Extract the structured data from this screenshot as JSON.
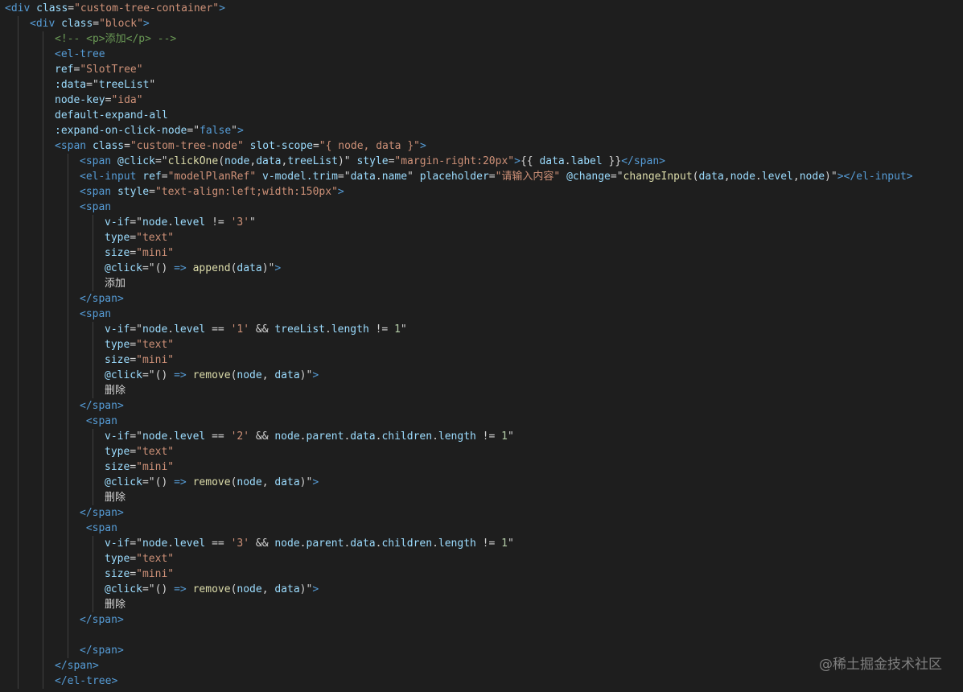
{
  "editor": {
    "language": "vue-html",
    "theme": "dark",
    "lines": [
      {
        "indent": 0,
        "tokens": [
          [
            "tag",
            "<div"
          ],
          [
            "text",
            " "
          ],
          [
            "attr",
            "class"
          ],
          [
            "text",
            "="
          ],
          [
            "str",
            "\"custom-tree-container\""
          ],
          [
            "tag",
            ">"
          ]
        ]
      },
      {
        "indent": 1,
        "tokens": [
          [
            "tag",
            "<div"
          ],
          [
            "text",
            " "
          ],
          [
            "attr",
            "class"
          ],
          [
            "text",
            "="
          ],
          [
            "str",
            "\"block\""
          ],
          [
            "tag",
            ">"
          ]
        ]
      },
      {
        "indent": 2,
        "tokens": [
          [
            "comment",
            "<!-- <p>添加</p> -->"
          ]
        ]
      },
      {
        "indent": 2,
        "tokens": [
          [
            "tag",
            "<el-tree"
          ]
        ]
      },
      {
        "indent": 2,
        "tokens": [
          [
            "attr",
            "ref"
          ],
          [
            "text",
            "="
          ],
          [
            "str",
            "\"SlotTree\""
          ]
        ]
      },
      {
        "indent": 2,
        "tokens": [
          [
            "attr",
            ":data"
          ],
          [
            "text",
            "=\""
          ],
          [
            "attr",
            "treeList"
          ],
          [
            "text",
            "\""
          ]
        ]
      },
      {
        "indent": 2,
        "tokens": [
          [
            "attr",
            "node-key"
          ],
          [
            "text",
            "="
          ],
          [
            "str",
            "\"ida\""
          ]
        ]
      },
      {
        "indent": 2,
        "tokens": [
          [
            "attr",
            "default-expand-all"
          ]
        ]
      },
      {
        "indent": 2,
        "tokens": [
          [
            "attr",
            ":expand-on-click-node"
          ],
          [
            "text",
            "=\""
          ],
          [
            "kw",
            "false"
          ],
          [
            "text",
            "\""
          ],
          [
            "tag",
            ">"
          ]
        ]
      },
      {
        "indent": 2,
        "tokens": [
          [
            "tag",
            "<span"
          ],
          [
            "text",
            " "
          ],
          [
            "attr",
            "class"
          ],
          [
            "text",
            "="
          ],
          [
            "str",
            "\"custom-tree-node\""
          ],
          [
            "text",
            " "
          ],
          [
            "attr",
            "slot-scope"
          ],
          [
            "text",
            "="
          ],
          [
            "str",
            "\"{ node, data }\""
          ],
          [
            "tag",
            ">"
          ]
        ]
      },
      {
        "indent": 3,
        "tokens": [
          [
            "tag",
            "<span"
          ],
          [
            "text",
            " "
          ],
          [
            "attr",
            "@click"
          ],
          [
            "text",
            "=\""
          ],
          [
            "fn",
            "clickOne"
          ],
          [
            "text",
            "("
          ],
          [
            "attr",
            "node"
          ],
          [
            "text",
            ","
          ],
          [
            "attr",
            "data"
          ],
          [
            "text",
            ","
          ],
          [
            "attr",
            "treeList"
          ],
          [
            "text",
            ")\" "
          ],
          [
            "attr",
            "style"
          ],
          [
            "text",
            "="
          ],
          [
            "str",
            "\"margin-right:20px\""
          ],
          [
            "tag",
            ">"
          ],
          [
            "text",
            "{{ "
          ],
          [
            "attr",
            "data"
          ],
          [
            "text",
            "."
          ],
          [
            "attr",
            "label"
          ],
          [
            "text",
            " }}"
          ],
          [
            "tag",
            "</span>"
          ]
        ]
      },
      {
        "indent": 3,
        "tokens": [
          [
            "tag",
            "<el-input"
          ],
          [
            "text",
            " "
          ],
          [
            "attr",
            "ref"
          ],
          [
            "text",
            "="
          ],
          [
            "str",
            "\"modelPlanRef\""
          ],
          [
            "text",
            " "
          ],
          [
            "attr",
            "v-model.trim"
          ],
          [
            "text",
            "=\""
          ],
          [
            "attr",
            "data"
          ],
          [
            "text",
            "."
          ],
          [
            "attr",
            "name"
          ],
          [
            "text",
            "\" "
          ],
          [
            "attr",
            "placeholder"
          ],
          [
            "text",
            "="
          ],
          [
            "str",
            "\"请输入内容\""
          ],
          [
            "text",
            " "
          ],
          [
            "attr",
            "@change"
          ],
          [
            "text",
            "=\""
          ],
          [
            "fn",
            "changeInput"
          ],
          [
            "text",
            "("
          ],
          [
            "attr",
            "data"
          ],
          [
            "text",
            ","
          ],
          [
            "attr",
            "node"
          ],
          [
            "text",
            "."
          ],
          [
            "attr",
            "level"
          ],
          [
            "text",
            ","
          ],
          [
            "attr",
            "node"
          ],
          [
            "text",
            ")\""
          ],
          [
            "tag",
            "></el-input>"
          ]
        ]
      },
      {
        "indent": 3,
        "tokens": [
          [
            "tag",
            "<span"
          ],
          [
            "text",
            " "
          ],
          [
            "attr",
            "style"
          ],
          [
            "text",
            "="
          ],
          [
            "str",
            "\"text-align:left;width:150px\""
          ],
          [
            "tag",
            ">"
          ]
        ]
      },
      {
        "indent": 3,
        "tokens": [
          [
            "tag",
            "<span"
          ]
        ]
      },
      {
        "indent": 4,
        "tokens": [
          [
            "attr",
            "v-if"
          ],
          [
            "text",
            "=\""
          ],
          [
            "attr",
            "node"
          ],
          [
            "text",
            "."
          ],
          [
            "attr",
            "level"
          ],
          [
            "text",
            " != "
          ],
          [
            "str",
            "'3'"
          ],
          [
            "text",
            "\""
          ]
        ]
      },
      {
        "indent": 4,
        "tokens": [
          [
            "attr",
            "type"
          ],
          [
            "text",
            "="
          ],
          [
            "str",
            "\"text\""
          ]
        ]
      },
      {
        "indent": 4,
        "tokens": [
          [
            "attr",
            "size"
          ],
          [
            "text",
            "="
          ],
          [
            "str",
            "\"mini\""
          ]
        ]
      },
      {
        "indent": 4,
        "tokens": [
          [
            "attr",
            "@click"
          ],
          [
            "text",
            "=\"() "
          ],
          [
            "kw",
            "=>"
          ],
          [
            "text",
            " "
          ],
          [
            "fn",
            "append"
          ],
          [
            "text",
            "("
          ],
          [
            "attr",
            "data"
          ],
          [
            "text",
            ")\""
          ],
          [
            "tag",
            ">"
          ]
        ]
      },
      {
        "indent": 4,
        "tokens": [
          [
            "text",
            "添加"
          ]
        ]
      },
      {
        "indent": 3,
        "tokens": [
          [
            "tag",
            "</span>"
          ]
        ]
      },
      {
        "indent": 3,
        "tokens": [
          [
            "tag",
            "<span"
          ]
        ]
      },
      {
        "indent": 4,
        "tokens": [
          [
            "attr",
            "v-if"
          ],
          [
            "text",
            "=\""
          ],
          [
            "attr",
            "node"
          ],
          [
            "text",
            "."
          ],
          [
            "attr",
            "level"
          ],
          [
            "text",
            " == "
          ],
          [
            "str",
            "'1'"
          ],
          [
            "text",
            " && "
          ],
          [
            "attr",
            "treeList"
          ],
          [
            "text",
            "."
          ],
          [
            "attr",
            "length"
          ],
          [
            "text",
            " != "
          ],
          [
            "num",
            "1"
          ],
          [
            "text",
            "\""
          ]
        ]
      },
      {
        "indent": 4,
        "tokens": [
          [
            "attr",
            "type"
          ],
          [
            "text",
            "="
          ],
          [
            "str",
            "\"text\""
          ]
        ]
      },
      {
        "indent": 4,
        "tokens": [
          [
            "attr",
            "size"
          ],
          [
            "text",
            "="
          ],
          [
            "str",
            "\"mini\""
          ]
        ]
      },
      {
        "indent": 4,
        "tokens": [
          [
            "attr",
            "@click"
          ],
          [
            "text",
            "=\"() "
          ],
          [
            "kw",
            "=>"
          ],
          [
            "text",
            " "
          ],
          [
            "fn",
            "remove"
          ],
          [
            "text",
            "("
          ],
          [
            "attr",
            "node"
          ],
          [
            "text",
            ", "
          ],
          [
            "attr",
            "data"
          ],
          [
            "text",
            ")\""
          ],
          [
            "tag",
            ">"
          ]
        ]
      },
      {
        "indent": 4,
        "tokens": [
          [
            "text",
            "删除"
          ]
        ]
      },
      {
        "indent": 3,
        "tokens": [
          [
            "tag",
            "</span>"
          ]
        ]
      },
      {
        "indent": 3,
        "tokens": [
          [
            "text",
            " "
          ],
          [
            "tag",
            "<span"
          ]
        ]
      },
      {
        "indent": 4,
        "tokens": [
          [
            "attr",
            "v-if"
          ],
          [
            "text",
            "=\""
          ],
          [
            "attr",
            "node"
          ],
          [
            "text",
            "."
          ],
          [
            "attr",
            "level"
          ],
          [
            "text",
            " == "
          ],
          [
            "str",
            "'2'"
          ],
          [
            "text",
            " && "
          ],
          [
            "attr",
            "node"
          ],
          [
            "text",
            "."
          ],
          [
            "attr",
            "parent"
          ],
          [
            "text",
            "."
          ],
          [
            "attr",
            "data"
          ],
          [
            "text",
            "."
          ],
          [
            "attr",
            "children"
          ],
          [
            "text",
            "."
          ],
          [
            "attr",
            "length"
          ],
          [
            "text",
            " != "
          ],
          [
            "num",
            "1"
          ],
          [
            "text",
            "\""
          ]
        ]
      },
      {
        "indent": 4,
        "tokens": [
          [
            "attr",
            "type"
          ],
          [
            "text",
            "="
          ],
          [
            "str",
            "\"text\""
          ]
        ]
      },
      {
        "indent": 4,
        "tokens": [
          [
            "attr",
            "size"
          ],
          [
            "text",
            "="
          ],
          [
            "str",
            "\"mini\""
          ]
        ]
      },
      {
        "indent": 4,
        "tokens": [
          [
            "attr",
            "@click"
          ],
          [
            "text",
            "=\"() "
          ],
          [
            "kw",
            "=>"
          ],
          [
            "text",
            " "
          ],
          [
            "fn",
            "remove"
          ],
          [
            "text",
            "("
          ],
          [
            "attr",
            "node"
          ],
          [
            "text",
            ", "
          ],
          [
            "attr",
            "data"
          ],
          [
            "text",
            ")\""
          ],
          [
            "tag",
            ">"
          ]
        ]
      },
      {
        "indent": 4,
        "tokens": [
          [
            "text",
            "删除"
          ]
        ]
      },
      {
        "indent": 3,
        "tokens": [
          [
            "tag",
            "</span>"
          ]
        ]
      },
      {
        "indent": 3,
        "tokens": [
          [
            "text",
            " "
          ],
          [
            "tag",
            "<span"
          ]
        ]
      },
      {
        "indent": 4,
        "tokens": [
          [
            "attr",
            "v-if"
          ],
          [
            "text",
            "=\""
          ],
          [
            "attr",
            "node"
          ],
          [
            "text",
            "."
          ],
          [
            "attr",
            "level"
          ],
          [
            "text",
            " == "
          ],
          [
            "str",
            "'3'"
          ],
          [
            "text",
            " && "
          ],
          [
            "attr",
            "node"
          ],
          [
            "text",
            "."
          ],
          [
            "attr",
            "parent"
          ],
          [
            "text",
            "."
          ],
          [
            "attr",
            "data"
          ],
          [
            "text",
            "."
          ],
          [
            "attr",
            "children"
          ],
          [
            "text",
            "."
          ],
          [
            "attr",
            "length"
          ],
          [
            "text",
            " != "
          ],
          [
            "num",
            "1"
          ],
          [
            "text",
            "\""
          ]
        ]
      },
      {
        "indent": 4,
        "tokens": [
          [
            "attr",
            "type"
          ],
          [
            "text",
            "="
          ],
          [
            "str",
            "\"text\""
          ]
        ]
      },
      {
        "indent": 4,
        "tokens": [
          [
            "attr",
            "size"
          ],
          [
            "text",
            "="
          ],
          [
            "str",
            "\"mini\""
          ]
        ]
      },
      {
        "indent": 4,
        "tokens": [
          [
            "attr",
            "@click"
          ],
          [
            "text",
            "=\"() "
          ],
          [
            "kw",
            "=>"
          ],
          [
            "text",
            " "
          ],
          [
            "fn",
            "remove"
          ],
          [
            "text",
            "("
          ],
          [
            "attr",
            "node"
          ],
          [
            "text",
            ", "
          ],
          [
            "attr",
            "data"
          ],
          [
            "text",
            ")\""
          ],
          [
            "tag",
            ">"
          ]
        ]
      },
      {
        "indent": 4,
        "tokens": [
          [
            "text",
            "删除"
          ]
        ]
      },
      {
        "indent": 3,
        "tokens": [
          [
            "tag",
            "</span>"
          ]
        ]
      },
      {
        "indent": 3,
        "tokens": []
      },
      {
        "indent": 3,
        "tokens": [
          [
            "tag",
            "</span>"
          ]
        ]
      },
      {
        "indent": 2,
        "tokens": [
          [
            "tag",
            "</span>"
          ]
        ]
      },
      {
        "indent": 2,
        "tokens": [
          [
            "tag",
            "</el-tree>"
          ]
        ]
      }
    ]
  },
  "watermark": {
    "text": "@稀土掘金技术社区"
  }
}
